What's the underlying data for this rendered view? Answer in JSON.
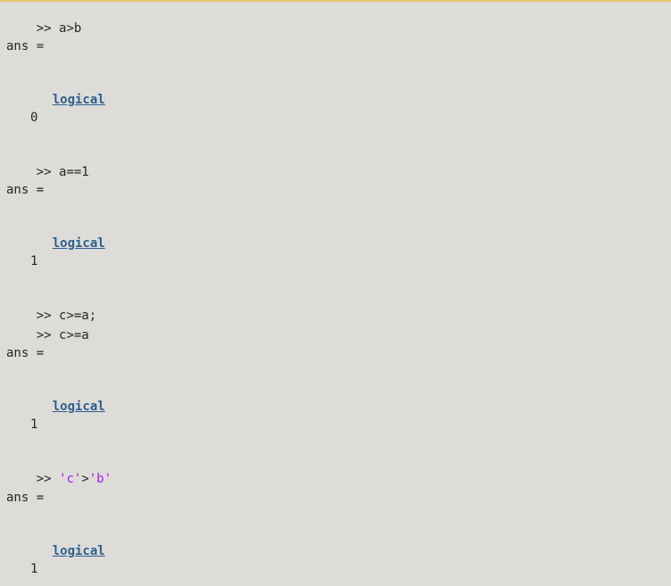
{
  "console": {
    "prompt": ">> ",
    "ans_label": "ans =",
    "type_link": "logical",
    "blocks": [
      {
        "cmd": "a>b",
        "value": "0"
      },
      {
        "cmd": "a==1",
        "value": "1"
      },
      {
        "cmd_silent": "c>=a;",
        "cmd": "c>=a",
        "value": "1"
      },
      {
        "cmd_parts": [
          "'c'",
          ">",
          "'b'"
        ],
        "value": "1"
      }
    ]
  },
  "colors": {
    "background": "#dedcd8",
    "text": "#262626",
    "link": "#2f5f8f",
    "string": "#a020f0",
    "accent": "#e8c66a"
  }
}
